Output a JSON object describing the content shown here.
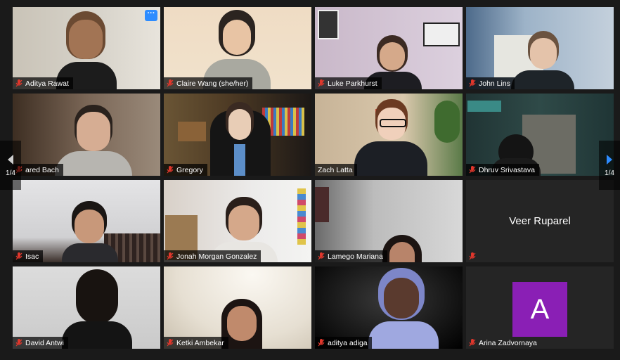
{
  "participants": [
    {
      "name": "Aditya Rawat"
    },
    {
      "name": "Claire Wang (she/her)"
    },
    {
      "name": "Luke Parkhurst"
    },
    {
      "name": "John Lins"
    },
    {
      "name": "ared Bach"
    },
    {
      "name": "Gregory"
    },
    {
      "name": "Zach Latta"
    },
    {
      "name": "Dhruv Srivastava"
    },
    {
      "name": "Isac"
    },
    {
      "name": "Jonah Morgan Gonzalez"
    },
    {
      "name": "Lamego Mariana"
    },
    {
      "name": "Veer Ruparel"
    },
    {
      "name": "David Antwi"
    },
    {
      "name": "Ketki Ambekar"
    },
    {
      "name": "aditya adiga"
    },
    {
      "name": "Arina Zadvornaya"
    }
  ],
  "video_off": {
    "label": "Veer Ruparel"
  },
  "avatar": {
    "initial": "A",
    "color": "#8a1fb5"
  },
  "more_button": {
    "label": "···"
  },
  "pager": {
    "left": "1/4",
    "right": "1/4"
  },
  "colors": {
    "active_speaker": "#d6e05a",
    "muted_icon": "#e0372c",
    "accent": "#2d8cff"
  }
}
